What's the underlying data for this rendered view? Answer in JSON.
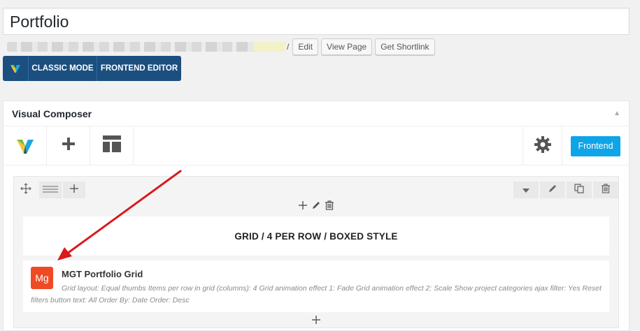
{
  "post": {
    "title": "Portfolio",
    "permalink_suffix": "/",
    "edit_label": "Edit",
    "view_label": "View Page",
    "shortlink_label": "Get Shortlink"
  },
  "mode_switch": {
    "classic_label": "CLASSIC MODE",
    "frontend_label": "FRONTEND EDITOR"
  },
  "composer": {
    "panel_title": "Visual Composer",
    "frontend_button": "Frontend"
  },
  "content": {
    "text_block": "GRID / 4 PER ROW / BOXED STYLE",
    "element": {
      "icon_text": "Mg",
      "title": "MGT Portfolio Grid",
      "description": "Grid layout: Equal thumbs  Items per row in grid (columns): 4  Grid animation effect 1: Fade  Grid animation effect 2: Scale  Show project categories ajax filter: Yes  Reset filters button text: All  Order By: Date  Order: Desc"
    }
  },
  "colors": {
    "switch_bg": "#1b4f7f",
    "frontend_button": "#0ea5e8",
    "element_icon": "#f04a24",
    "arrow": "#d9191c"
  },
  "icons": [
    "vc-logo-icon",
    "plus-icon",
    "template-icon",
    "gear-icon",
    "move-icon",
    "columns-icon",
    "chevron-down-icon",
    "pencil-icon",
    "clone-icon",
    "trash-icon"
  ]
}
